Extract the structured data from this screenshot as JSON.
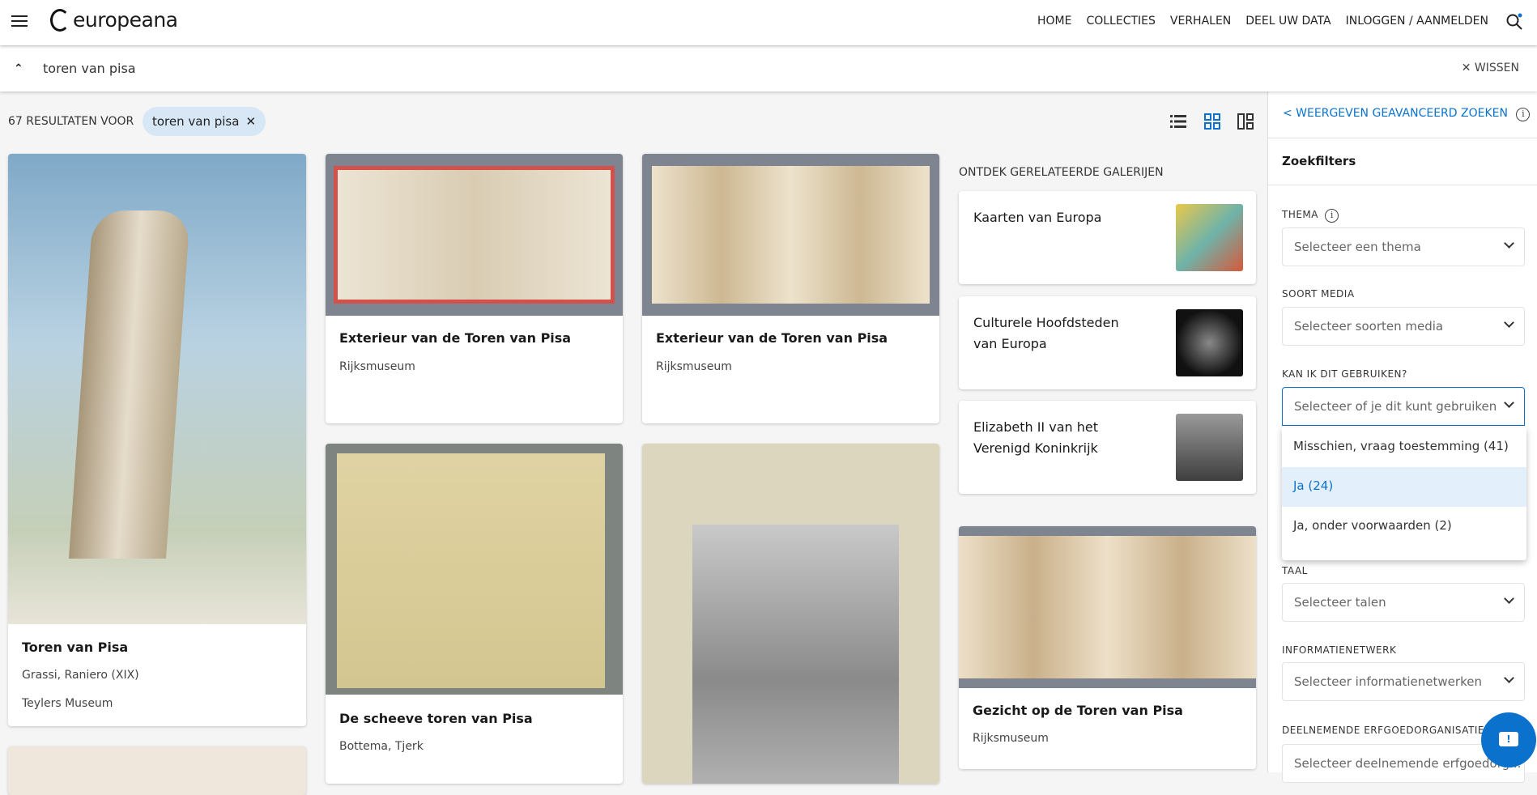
{
  "header": {
    "logo": "europeana",
    "nav": [
      "HOME",
      "COLLECTIES",
      "VERHALEN",
      "DEEL UW DATA",
      "INLOGGEN / AANMELDEN"
    ]
  },
  "search": {
    "query": "toren van pisa",
    "clear": "WISSEN"
  },
  "results": {
    "count_label": "67 RESULTATEN VOOR",
    "chip": "toren van pisa"
  },
  "cards": [
    {
      "title": "Toren van Pisa",
      "creator": "Grassi, Raniero (XIX)",
      "provider": "Teylers Museum"
    },
    {
      "title": "Exterieur van de Toren van Pisa",
      "provider": "Rijksmuseum"
    },
    {
      "title": "Exterieur van de Toren van Pisa",
      "provider": "Rijksmuseum"
    },
    {
      "title": "De scheeve toren van Pisa",
      "creator": "Bottema, Tjerk"
    },
    {
      "title": "Gezicht op de Toren van Pisa",
      "provider": "Rijksmuseum"
    }
  ],
  "galleries": {
    "heading": "ONTDEK GERELATEERDE GALERIJEN",
    "items": [
      "Kaarten van Europa",
      "Culturele Hoofdsteden van Europa",
      "Elizabeth II van het Verenigd Koninkrijk"
    ]
  },
  "panel": {
    "advanced": "< WEERGEVEN GEAVANCEERD ZOEKEN",
    "title": "Zoekfilters",
    "filters": [
      {
        "label": "THEMA",
        "placeholder": "Selecteer een thema"
      },
      {
        "label": "SOORT MEDIA",
        "placeholder": "Selecteer soorten media"
      },
      {
        "label": "KAN IK DIT GEBRUIKEN?",
        "placeholder": "Selecteer of je dit kunt gebruiken"
      },
      {
        "label": "TAAL",
        "placeholder": "Selecteer talen"
      },
      {
        "label": "INFORMATIENETWERK",
        "placeholder": "Selecteer informatienetwerken"
      },
      {
        "label": "DEELNEMENDE ERFGOEDORGANISATIE",
        "placeholder": "Selecteer deelnemende erfgoedorg..."
      }
    ],
    "dropdown_options": [
      "Misschien, vraag toestemming (41)",
      "Ja (24)",
      "Ja, onder voorwaarden (2)"
    ],
    "highlighted_option": "Ja (24)"
  },
  "colors": {
    "accent": "#0a72cc",
    "chip": "#d8e7f6",
    "highlight": "#e3f0fc"
  }
}
